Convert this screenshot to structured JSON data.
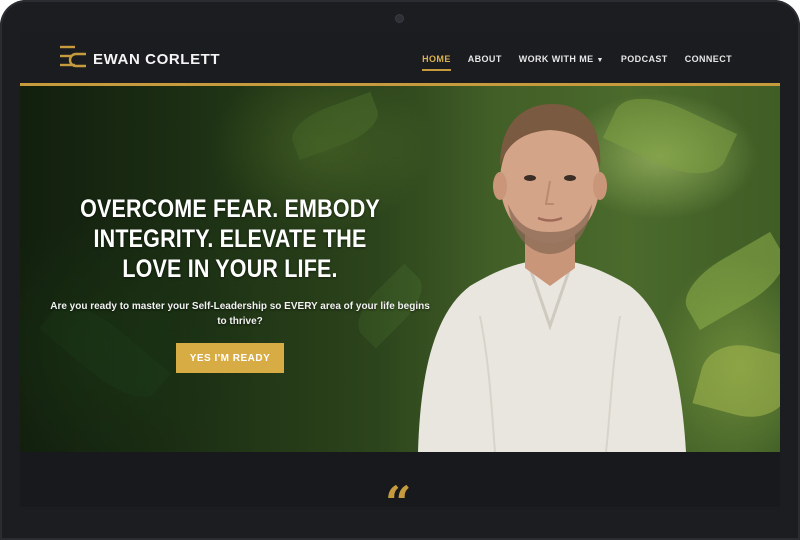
{
  "brand": {
    "name": "EWAN CORLETT",
    "accent": "#c59b3d"
  },
  "nav": {
    "items": [
      {
        "label": "HOME",
        "active": true
      },
      {
        "label": "ABOUT"
      },
      {
        "label": "WORK WITH ME",
        "dropdown": true
      },
      {
        "label": "PODCAST"
      },
      {
        "label": "CONNECT"
      }
    ]
  },
  "hero": {
    "headline": "OVERCOME FEAR. EMBODY INTEGRITY. ELEVATE THE LOVE IN YOUR LIFE.",
    "subhead": "Are you ready to master your Self-Leadership so EVERY area of your life begins to thrive?",
    "cta_label": "YES I'M READY"
  },
  "section": {
    "quote_mark": "“"
  }
}
